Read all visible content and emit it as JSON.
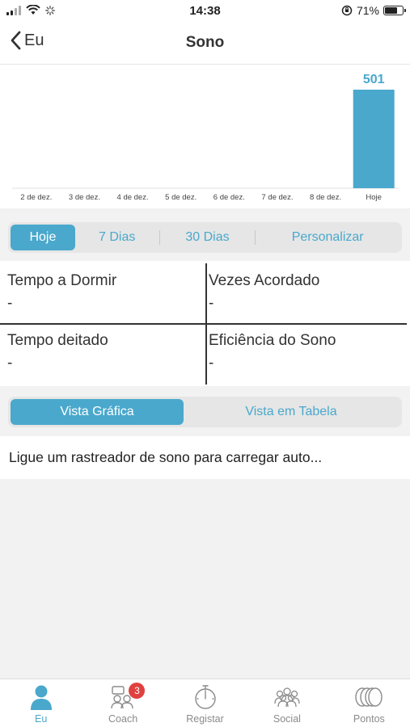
{
  "status_bar": {
    "time": "14:38",
    "battery": "71%"
  },
  "nav": {
    "back_label": "Eu",
    "title": "Sono"
  },
  "chart_data": {
    "type": "bar",
    "categories": [
      "2 de dez.",
      "3 de dez.",
      "4 de dez.",
      "5 de dez.",
      "6 de dez.",
      "7 de dez.",
      "8 de dez.",
      "Hoje"
    ],
    "values": [
      0,
      0,
      0,
      0,
      0,
      0,
      0,
      501
    ],
    "data_labels": [
      "",
      "",
      "",
      "",
      "",
      "",
      "",
      "501"
    ],
    "ylim": [
      0,
      501
    ],
    "bar_color": "#4aa8cc",
    "title": "",
    "xlabel": "",
    "ylabel": ""
  },
  "range_tabs": [
    {
      "label": "Hoje",
      "active": true
    },
    {
      "label": "7 Dias",
      "active": false
    },
    {
      "label": "30 Dias",
      "active": false
    },
    {
      "label": "Personalizar",
      "active": false
    }
  ],
  "stats": [
    {
      "label": "Tempo a Dormir",
      "value": "-"
    },
    {
      "label": "Vezes Acordado",
      "value": "-"
    },
    {
      "label": "Tempo deitado",
      "value": "-"
    },
    {
      "label": "Eficiência do Sono",
      "value": "-"
    }
  ],
  "view_tabs": [
    {
      "label": "Vista Gráfica",
      "active": true
    },
    {
      "label": "Vista em Tabela",
      "active": false
    }
  ],
  "info_text": "Ligue um rastreador de sono para carregar auto...",
  "bottom_tabs": [
    {
      "label": "Eu",
      "icon": "person-icon",
      "active": true
    },
    {
      "label": "Coach",
      "icon": "coach-icon",
      "active": false,
      "badge": "3"
    },
    {
      "label": "Registar",
      "icon": "stopwatch-icon",
      "active": false
    },
    {
      "label": "Social",
      "icon": "group-icon",
      "active": false
    },
    {
      "label": "Pontos",
      "icon": "coins-icon",
      "active": false
    }
  ],
  "colors": {
    "accent": "#4aa8cc",
    "badge": "#e0413f"
  }
}
